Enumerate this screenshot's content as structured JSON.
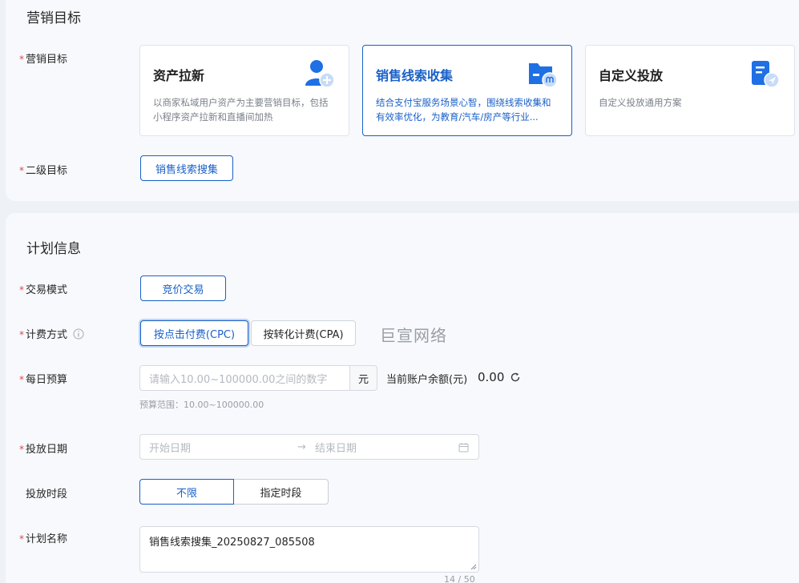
{
  "goal_section": {
    "title": "营销目标",
    "goal_label": "营销目标",
    "cards": [
      {
        "title": "资产拉新",
        "desc": "以商家私域用户资产为主要营销目标，包括小程序资产拉新和直播间加热",
        "icon": "user-add-icon"
      },
      {
        "title": "销售线索收集",
        "desc": "结合支付宝服务场景心智，围绕线索收集和有效率优化，为教育/汽车/房产等行业...",
        "icon": "folder-clue-icon"
      },
      {
        "title": "自定义投放",
        "desc": "自定义投放通用方案",
        "icon": "document-send-icon"
      }
    ],
    "selected_card": "销售线索收集",
    "sub_goal_label": "二级目标",
    "sub_goal_value": "销售线索搜集"
  },
  "plan_section": {
    "title": "计划信息",
    "trade_mode_label": "交易模式",
    "trade_mode_value": "竞价交易",
    "billing_label": "计费方式",
    "billing_options": [
      "按点击付费(CPC)",
      "按转化计费(CPA)"
    ],
    "billing_selected": "按点击付费(CPC)",
    "watermark": "巨宣网络",
    "budget_label": "每日预算",
    "budget_placeholder": "请输入10.00~100000.00之间的数字",
    "budget_unit": "元",
    "balance_label": "当前账户余额(元)",
    "balance_value": "0.00",
    "budget_hint": "预算范围：10.00~100000.00",
    "date_label": "投放日期",
    "start_placeholder": "开始日期",
    "end_placeholder": "结束日期",
    "date_separator": "→",
    "period_label": "投放时段",
    "period_options": [
      "不限",
      "指定时段"
    ],
    "period_selected": "不限",
    "name_label": "计划名称",
    "name_value": "销售线索搜集_20250827_085508",
    "name_counter": "14 / 50"
  },
  "colors": {
    "accent": "#1960c8",
    "required": "#e54545",
    "page_bg": "#eef1f6",
    "panel_bg": "#f7f9fc"
  }
}
